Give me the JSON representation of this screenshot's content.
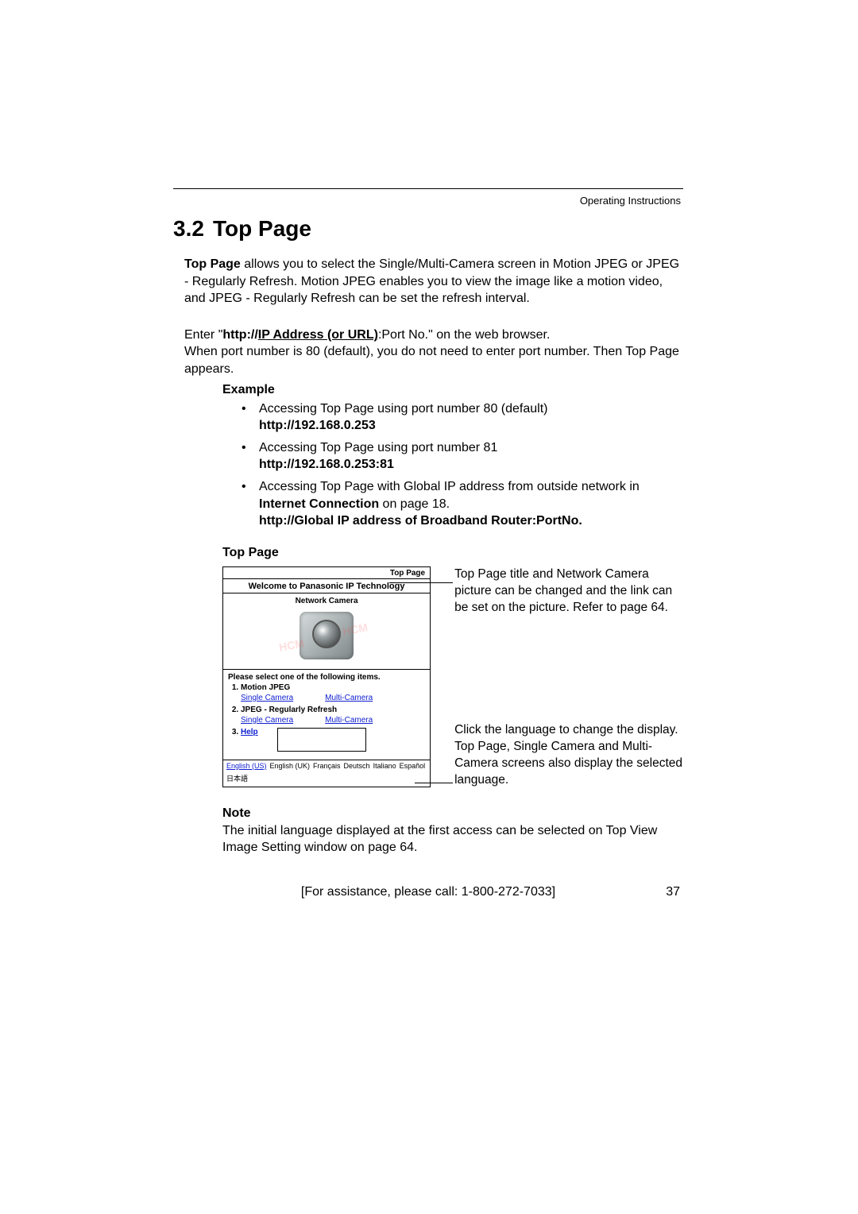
{
  "header": {
    "label": "Operating Instructions"
  },
  "section": {
    "number": "3.2",
    "title": "Top Page"
  },
  "intro": {
    "lead_bold": "Top Page",
    "rest": " allows you to select the Single/Multi-Camera screen in Motion JPEG or JPEG - Regularly Refresh. Motion JPEG enables you to view the image like a motion video, and JPEG - Regularly Refresh can be set the refresh interval."
  },
  "browser": {
    "pre": "Enter \"",
    "bold_http": "http://",
    "ul_bold": "IP Address (or URL)",
    "post": ":Port No.\" on the web browser.",
    "line2": "When port number is 80 (default), you do not need to enter port number. Then Top Page appears."
  },
  "example_label": "Example",
  "bullets": [
    {
      "text": "Accessing Top Page using port number 80 (default)",
      "bold": "http://192.168.0.253"
    },
    {
      "text": "Accessing Top Page using port number 81",
      "bold": "http://192.168.0.253:81"
    },
    {
      "text_pre": "Accessing Top Page with Global IP address from outside network in ",
      "bold1": "Internet Connection",
      "text_mid": " on page 18.",
      "bold2": "http://Global IP address of Broadband Router:PortNo."
    }
  ],
  "subhead": "Top Page",
  "toppage": {
    "header": "Top Page",
    "welcome": "Welcome to Panasonic IP Technology",
    "netcam": "Network Camera",
    "prompt": "Please select one of the following items.",
    "items": [
      {
        "label": "Motion JPEG",
        "links": [
          "Single Camera",
          "Multi-Camera"
        ]
      },
      {
        "label": "JPEG - Regularly Refresh",
        "links": [
          "Single Camera",
          "Multi-Camera"
        ]
      },
      {
        "label": "Help",
        "links": []
      }
    ],
    "languages": {
      "selected": "English (US)",
      "others": [
        "English (UK)",
        "Français",
        "Deutsch",
        "Italiano",
        "Español",
        "日本語"
      ]
    }
  },
  "callout_top": "Top Page title and Network Camera picture can be changed and the link can be set on the picture. Refer to page 64.",
  "callout_bottom": "Click the language to change the display. Top Page, Single Camera and Multi-Camera screens also display the selected language.",
  "note_head": "Note",
  "note_body": "The initial language displayed at the first access can be selected on Top View Image Setting window on page 64.",
  "footer": {
    "assist": "[For assistance, please call: 1-800-272-7033]",
    "page": "37"
  }
}
